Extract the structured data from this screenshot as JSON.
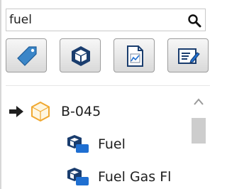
{
  "search": {
    "value": "fuel",
    "icon": "search-icon"
  },
  "toolbar": {
    "buttons": [
      {
        "name": "tag-button",
        "icon": "tag-icon"
      },
      {
        "name": "object-button",
        "icon": "cube-icon"
      },
      {
        "name": "report-button",
        "icon": "chart-document-icon"
      },
      {
        "name": "edit-button",
        "icon": "edit-form-icon"
      }
    ]
  },
  "tree": {
    "parent": {
      "label": "B-045",
      "icon": "hexagon-icon",
      "accent": "#f0a830"
    },
    "children": [
      {
        "label": "Fuel",
        "icon": "blue-cube-icon"
      },
      {
        "label": "Fuel Gas Fl",
        "icon": "blue-cube-icon"
      }
    ]
  },
  "colors": {
    "accent_blue": "#1f6fd1",
    "tag_blue": "#3b86c8"
  }
}
